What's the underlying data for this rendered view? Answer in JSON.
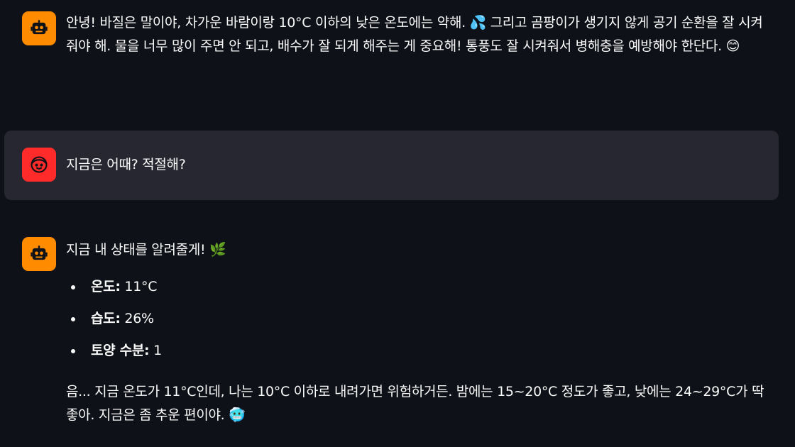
{
  "messages": [
    {
      "role": "assistant",
      "text": "안녕! 바질은 말이야, 차가운 바람이랑 10°C 이하의 낮은 온도에는 약해. 💦 그리고 곰팡이가 생기지 않게 공기 순환을 잘 시켜줘야 해. 물을 너무 많이 주면 안 되고, 배수가 잘 되게 해주는 게 중요해! 통풍도 잘 시켜줘서 병해충을 예방해야 한단다. 😊",
      "avatar_icon": "robot-face-icon"
    },
    {
      "role": "user",
      "text": "지금은 어때? 적절해?",
      "avatar_icon": "user-face-icon"
    },
    {
      "role": "assistant",
      "intro": "지금 내 상태를 알려줄게! 🌿",
      "stats": [
        {
          "label": "온도:",
          "value": "11°C"
        },
        {
          "label": "습도:",
          "value": "26%"
        },
        {
          "label": "토양 수분:",
          "value": "1"
        }
      ],
      "outro": "음... 지금 온도가 11°C인데, 나는 10°C 이하로 내려가면 위험하거든. 밤에는 15~20°C 정도가 좋고, 낮에는 24~29°C가 딱 좋아. 지금은 좀 추운 편이야. 🥶",
      "avatar_icon": "robot-face-icon"
    }
  ],
  "colors": {
    "background": "#0e1117",
    "user_bubble": "#262730",
    "bot_avatar": "#ff8c00",
    "user_avatar": "#ff2b2b",
    "text": "#fafafa"
  }
}
